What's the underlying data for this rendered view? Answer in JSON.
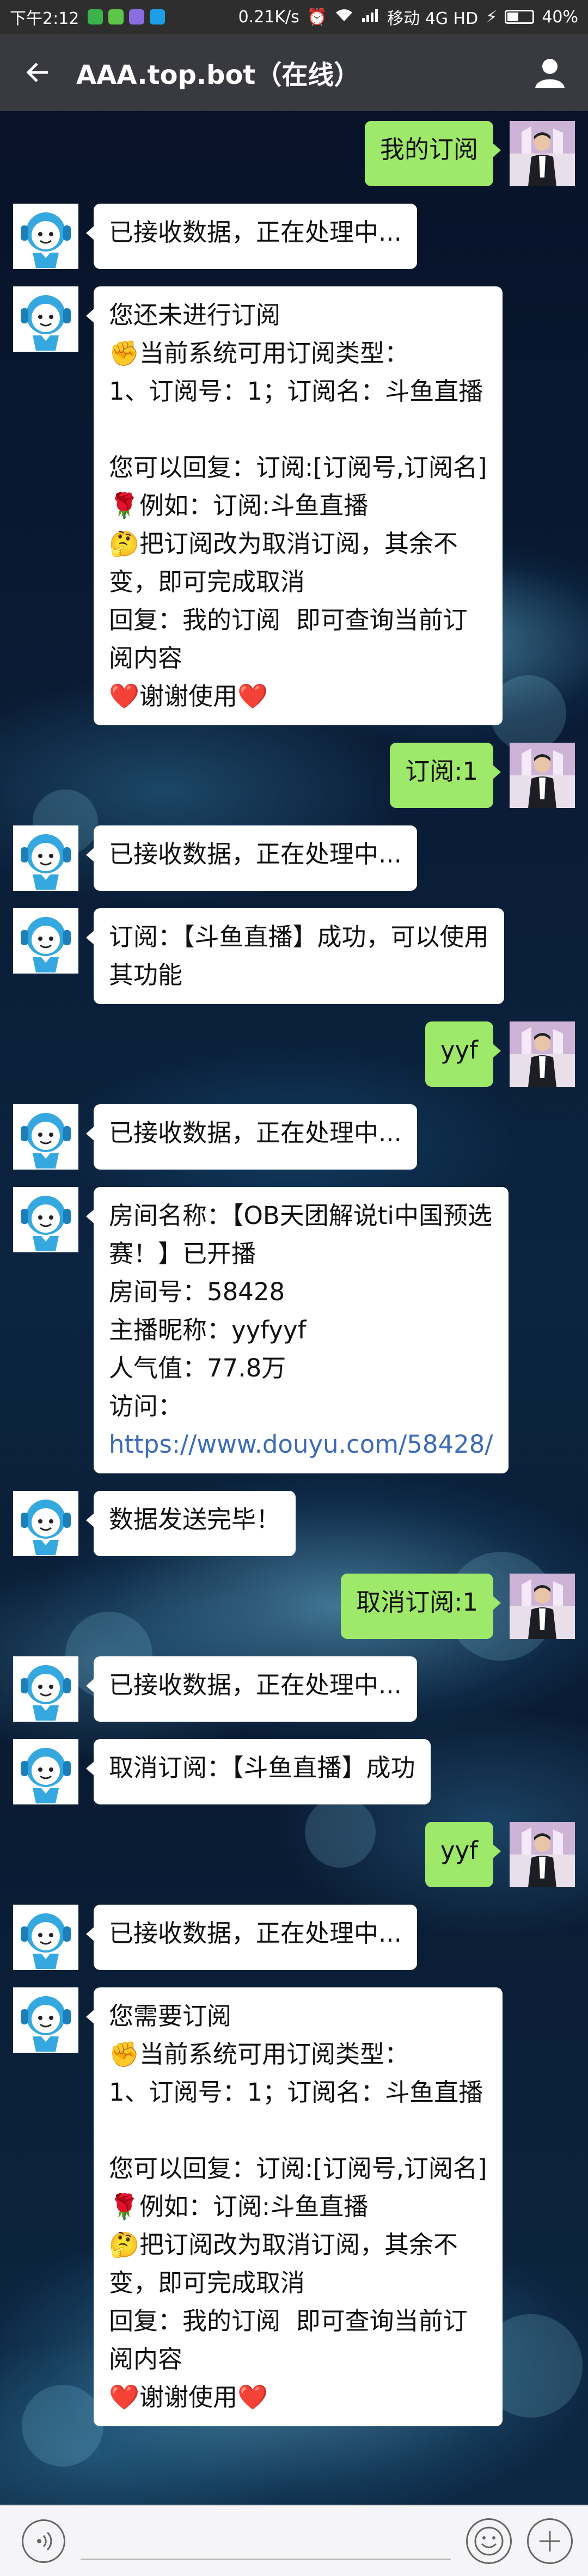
{
  "status_bar": {
    "time": "下午2:12",
    "speed": "0.21K/s",
    "carrier": "移动 4G HD",
    "battery": "40%"
  },
  "header": {
    "title": "AAA.top.bot（在线）",
    "back_icon": "arrow-left-icon",
    "profile_icon": "person-icon"
  },
  "messages": [
    {
      "from": "me",
      "lines": [
        "我的订阅"
      ]
    },
    {
      "from": "bot",
      "lines": [
        "已接收数据，正在处理中..."
      ]
    },
    {
      "from": "bot",
      "lines": [
        "您还未进行订阅",
        "✊当前系统可用订阅类型：",
        "1、订阅号：1；订阅名：斗鱼直播",
        "",
        "您可以回复：订阅:[订阅号,订阅名]",
        "🌹例如：订阅:斗鱼直播",
        "🤔把订阅改为取消订阅，其余不",
        "变，即可完成取消",
        "回复：我的订阅  即可查询当前订",
        "阅内容",
        "❤️谢谢使用❤️"
      ]
    },
    {
      "from": "me",
      "lines": [
        "订阅:1"
      ]
    },
    {
      "from": "bot",
      "lines": [
        "已接收数据，正在处理中..."
      ]
    },
    {
      "from": "bot",
      "lines": [
        "订阅：【斗鱼直播】成功，可以使用",
        "其功能"
      ]
    },
    {
      "from": "me",
      "lines": [
        "yyf"
      ]
    },
    {
      "from": "bot",
      "lines": [
        "已接收数据，正在处理中..."
      ]
    },
    {
      "from": "bot",
      "lines": [
        "房间名称：【OB天团解说ti中国预选",
        "赛！】已开播",
        "房间号：58428",
        "主播昵称：yyfyyf",
        "人气值：77.8万",
        "访问："
      ],
      "link": "https://www.douyu.com/58428/"
    },
    {
      "from": "bot",
      "lines": [
        "数据发送完毕！"
      ]
    },
    {
      "from": "me",
      "lines": [
        "取消订阅:1"
      ]
    },
    {
      "from": "bot",
      "lines": [
        "已接收数据，正在处理中..."
      ]
    },
    {
      "from": "bot",
      "lines": [
        "取消订阅：【斗鱼直播】成功"
      ]
    },
    {
      "from": "me",
      "lines": [
        "yyf"
      ]
    },
    {
      "from": "bot",
      "lines": [
        "已接收数据，正在处理中..."
      ]
    },
    {
      "from": "bot",
      "lines": [
        "您需要订阅",
        "✊当前系统可用订阅类型：",
        "1、订阅号：1；订阅名：斗鱼直播",
        "",
        "您可以回复：订阅:[订阅号,订阅名]",
        "🌹例如：订阅:斗鱼直播",
        "🤔把订阅改为取消订阅，其余不",
        "变，即可完成取消",
        "回复：我的订阅  即可查询当前订",
        "阅内容",
        "❤️谢谢使用❤️"
      ]
    }
  ],
  "input_bar": {
    "voice_icon": "voice-icon",
    "emoji_icon": "emoji-icon",
    "plus_icon": "plus-icon"
  }
}
